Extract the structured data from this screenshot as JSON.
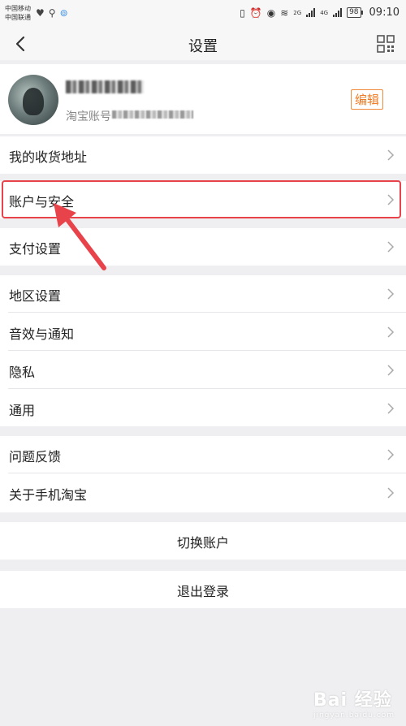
{
  "status_bar": {
    "carrier1": "中国移动",
    "carrier2": "中国联通",
    "network1": "2G",
    "network2": "4G",
    "battery": "98",
    "time": "09:10"
  },
  "nav": {
    "title": "设置",
    "back_icon": "chevron-left-icon",
    "qr_icon": "grid-icon"
  },
  "profile": {
    "account_label": "淘宝账号",
    "edit_label": "编辑"
  },
  "groups": [
    {
      "items": [
        {
          "label": "我的收货地址"
        }
      ]
    },
    {
      "items": [
        {
          "label": "账户与安全"
        }
      ]
    },
    {
      "items": [
        {
          "label": "支付设置"
        }
      ]
    },
    {
      "items": [
        {
          "label": "地区设置"
        },
        {
          "label": "音效与通知"
        },
        {
          "label": "隐私"
        },
        {
          "label": "通用"
        }
      ]
    },
    {
      "items": [
        {
          "label": "问题反馈"
        },
        {
          "label": "关于手机淘宝"
        }
      ]
    }
  ],
  "actions": {
    "switch_account": "切换账户",
    "logout": "退出登录"
  },
  "watermark": {
    "text": "Bai 经验",
    "sub": "jingyan.baidu.com"
  },
  "colors": {
    "highlight": "#e8434b",
    "edit_accent": "#f07a22",
    "background": "#efeff2"
  }
}
